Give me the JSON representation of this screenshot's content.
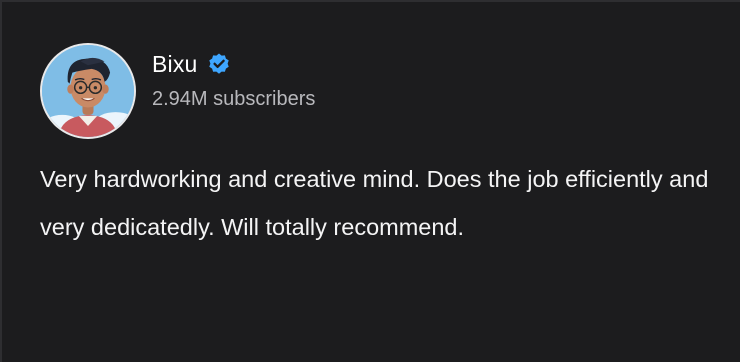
{
  "channel": {
    "name": "Bixu",
    "subscribers": "2.94M subscribers",
    "verified": true,
    "avatar_icon": "cartoon-boy-avatar",
    "verified_icon": "verified-badge-icon",
    "verified_color": "#3ea6ff"
  },
  "review": {
    "text": "Very hardworking and creative mind. Does the job efficiently and very dedicatedly. Will totally recommend."
  },
  "colors": {
    "background": "#1c1c1e",
    "text_primary": "#ffffff",
    "text_secondary": "#b8b8bc"
  }
}
